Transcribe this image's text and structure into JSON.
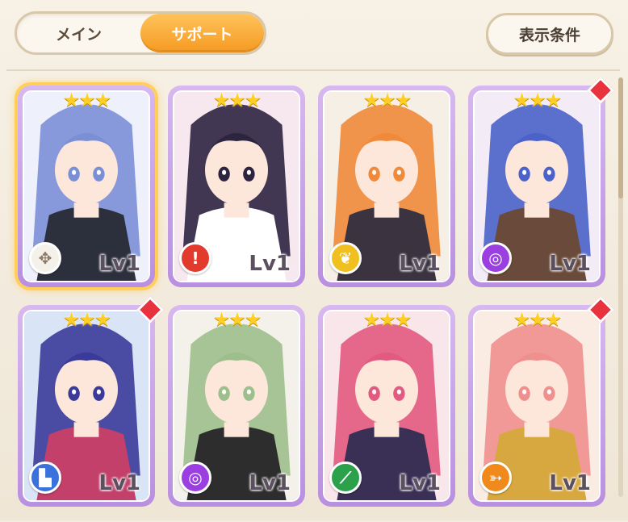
{
  "tabs": [
    {
      "label": "メイン",
      "active": false
    },
    {
      "label": "サポート",
      "active": true
    }
  ],
  "filter_button": {
    "label": "表示条件"
  },
  "cards": [
    {
      "stars": "★★★",
      "level": "Lv1",
      "element": "wind-icon",
      "element_color": "#f4f1ea",
      "new": false,
      "selected": true,
      "palette": [
        "#eef1fb",
        "#7b8fd6",
        "#2c2f3c"
      ]
    },
    {
      "stars": "★★★",
      "level": "Lv1",
      "element": "fire-icon",
      "element_color": "#e23b2e",
      "new": false,
      "selected": false,
      "palette": [
        "#f7e8ef",
        "#2d2440",
        "#ffffff"
      ]
    },
    {
      "stars": "★★★",
      "level": "Lv1",
      "element": "light-icon",
      "element_color": "#f0c020",
      "new": false,
      "selected": false,
      "palette": [
        "#f6efe6",
        "#f08a3a",
        "#3b3440"
      ]
    },
    {
      "stars": "★★★",
      "level": "Lv1",
      "element": "dark-swirl-icon",
      "element_color": "#9b3fe0",
      "new": true,
      "selected": false,
      "palette": [
        "#f3ecf6",
        "#4a62c9",
        "#6a4a3a"
      ]
    },
    {
      "stars": "★★★",
      "level": "Lv1",
      "element": "boot-icon",
      "element_color": "#3a72dd",
      "new": true,
      "selected": false,
      "palette": [
        "#d9e4f6",
        "#3a3a9a",
        "#c3406a"
      ]
    },
    {
      "stars": "★★★",
      "level": "Lv1",
      "element": "dark-swirl-icon",
      "element_color": "#9b3fe0",
      "new": false,
      "selected": false,
      "palette": [
        "#f3f1ea",
        "#9dbf8c",
        "#2d2d2d"
      ]
    },
    {
      "stars": "★★★",
      "level": "Lv1",
      "element": "wand-icon",
      "element_color": "#2aa14a",
      "new": false,
      "selected": false,
      "palette": [
        "#f9e6ea",
        "#e25a80",
        "#3a2f55"
      ]
    },
    {
      "stars": "★★★",
      "level": "Lv1",
      "element": "bow-icon",
      "element_color": "#f08a1c",
      "new": true,
      "selected": false,
      "palette": [
        "#fbece3",
        "#f0908e",
        "#d8a840"
      ]
    }
  ]
}
